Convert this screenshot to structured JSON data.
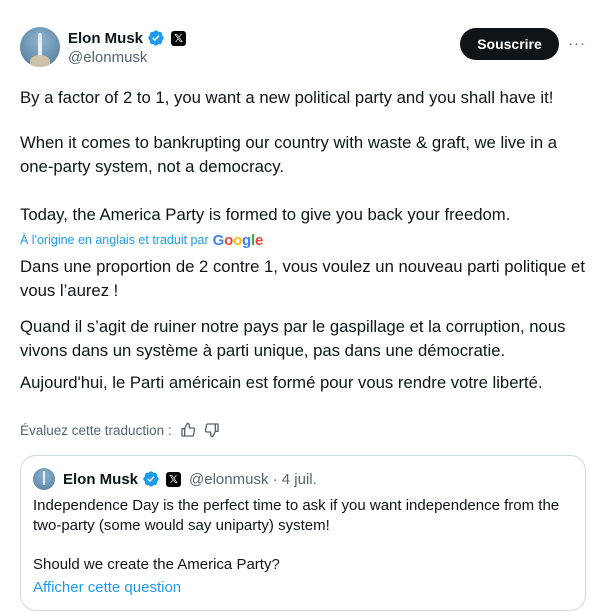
{
  "author": {
    "display_name": "Elon Musk",
    "handle": "@elonmusk",
    "verified_icon": "verified-badge-icon",
    "affiliation_icon": "x-logo-icon",
    "affiliation_glyph": "𝕏"
  },
  "header": {
    "subscribe_label": "Souscrire",
    "more_glyph": "···"
  },
  "tweet": {
    "original_paragraphs": [
      "By a factor of 2 to 1, you want a new political party and you shall have it!",
      "When it comes to bankrupting our country with waste & graft, we live in a one-party system, not a democracy.",
      "Today, the America Party is formed to give you back your freedom."
    ],
    "translation_note": "À l'origine en anglais et traduit par",
    "translation_provider": "Google",
    "translated_paragraphs": [
      "Dans une proportion de 2 contre 1, vous voulez un nouveau parti politique et vous l’aurez !",
      "Quand il s’agit de ruiner notre pays par le gaspillage et la corruption, nous vivons dans un système à parti unique, pas dans une démocratie.",
      "Aujourd'hui, le Parti américain est formé pour vous rendre votre liberté."
    ],
    "rate_translation_label": "Évaluez cette traduction :"
  },
  "quoted_tweet": {
    "display_name": "Elon Musk",
    "handle_date": "@elonmusk · 4 juil.",
    "text_1": "Independence Day is the perfect time to ask if you want independence from the two-party (some would say uniparty) system!",
    "text_2": "Should we create the America Party?",
    "show_question_label": "Afficher cette question"
  },
  "colors": {
    "accent": "#1d9bf0",
    "text": "#0f1419",
    "secondary": "#536471",
    "border": "#cfd9de"
  }
}
